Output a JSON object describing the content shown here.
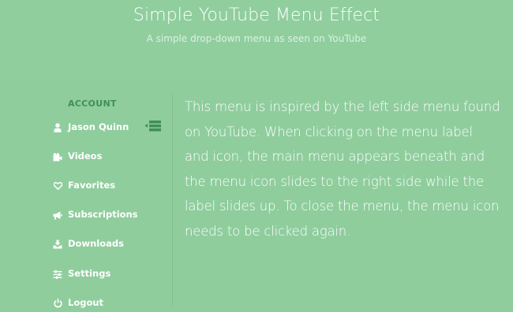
{
  "header": {
    "title": "Simple YouTube Menu Effect",
    "subtitle": "A simple drop-down menu as seen on YouTube"
  },
  "sidebar": {
    "section_label": "ACCOUNT",
    "items": [
      {
        "label": "Jason Quinn",
        "icon": "user-icon"
      },
      {
        "label": "Videos",
        "icon": "video-icon"
      },
      {
        "label": "Favorites",
        "icon": "heart-icon"
      },
      {
        "label": "Subscriptions",
        "icon": "megaphone-icon"
      },
      {
        "label": "Downloads",
        "icon": "download-icon"
      },
      {
        "label": "Settings",
        "icon": "sliders-icon"
      },
      {
        "label": "Logout",
        "icon": "power-icon"
      }
    ],
    "toggle_icon": "menu-toggle-icon"
  },
  "main": {
    "description": "This menu is inspired by the left side menu found on YouTube. When clicking on the menu label and icon, the main menu appears beneath and the menu icon slides to the right side while the label slides up. To close the menu, the menu icon needs to be clicked again."
  },
  "colors": {
    "background": "#8fcd9d",
    "section_label": "#3f8f58",
    "text": "#ffffff"
  }
}
